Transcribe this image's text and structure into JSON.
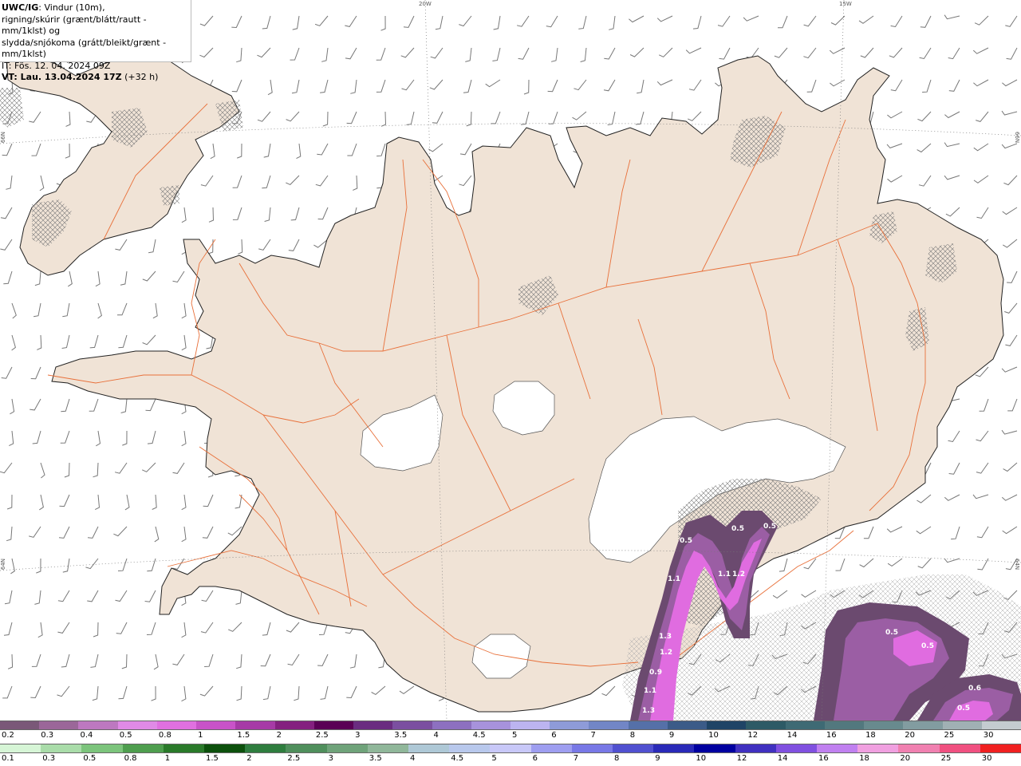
{
  "header": {
    "model": "UWC/IG",
    "line1": ": Vindur (10m),",
    "line2": "rigning/skúrir (grænt/blátt/rautt - mm/1klst) og",
    "line3": "slydda/snjókoma (grátt/bleikt/grænt - mm/1klst)",
    "it_line": "IT: Fös. 12. 04. 2024 09Z",
    "vt_label": "VT: Lau. 13.04.2024 17Z",
    "vt_offset": " (+32 h)"
  },
  "graticule": {
    "lon_labels": [
      "20W",
      "15W"
    ],
    "lat_labels": [
      "66N",
      "66N",
      "64N",
      "64N"
    ]
  },
  "map_values": [
    {
      "label": "0.5",
      "id": "v1"
    },
    {
      "label": "0.5",
      "id": "v2"
    },
    {
      "label": "0.5",
      "id": "v3"
    },
    {
      "label": "1.1",
      "id": "v4"
    },
    {
      "label": "1.1",
      "id": "v5"
    },
    {
      "label": "1.2",
      "id": "v6"
    },
    {
      "label": "1.3",
      "id": "v7"
    },
    {
      "label": "1.2",
      "id": "v8"
    },
    {
      "label": "0.9",
      "id": "v9"
    },
    {
      "label": "1.1",
      "id": "v10"
    },
    {
      "label": "1.3",
      "id": "v11"
    },
    {
      "label": "0.5",
      "id": "v12"
    },
    {
      "label": "0.5",
      "id": "v13"
    },
    {
      "label": "0.6",
      "id": "v14"
    },
    {
      "label": "0.5",
      "id": "v15"
    }
  ],
  "legend_snow": {
    "labels": [
      "0.2",
      "0.3",
      "0.4",
      "0.5",
      "0.8",
      "1",
      "1.5",
      "2",
      "2.5",
      "3",
      "3.5",
      "4",
      "4.5",
      "5",
      "6",
      "7",
      "8",
      "9",
      "10",
      "12",
      "14",
      "16",
      "18",
      "20",
      "25",
      "30"
    ],
    "colors": [
      "#7a5878",
      "#9b6799",
      "#bd78c0",
      "#e08ae6",
      "#e070e0",
      "#c853c8",
      "#a63aa6",
      "#84207f",
      "#5a0055",
      "#6a2c80",
      "#7b4fa0",
      "#8d70c0",
      "#a792dc",
      "#bcb4f0",
      "#8e9bd8",
      "#7286c6",
      "#5570a8",
      "#3b5b88",
      "#1f4466",
      "#2d5a66",
      "#3e6a74",
      "#52787e",
      "#688a8e",
      "#829ca0",
      "#a0b0b4",
      "#c4ccd0"
    ]
  },
  "legend_rain": {
    "labels": [
      "0.1",
      "0.3",
      "0.5",
      "0.8",
      "1",
      "1.5",
      "2",
      "2.5",
      "3",
      "3.5",
      "4",
      "4.5",
      "5",
      "6",
      "7",
      "8",
      "9",
      "10",
      "12",
      "14",
      "16",
      "18",
      "20",
      "25",
      "30"
    ],
    "colors": [
      "#d6f5d6",
      "#a9dca9",
      "#7cc47c",
      "#4e9e4e",
      "#2a7a2a",
      "#0c500c",
      "#2e7d3e",
      "#4f8f5c",
      "#6fa37a",
      "#90b79a",
      "#aec8d6",
      "#b8c8ec",
      "#c8c8f8",
      "#9e9ef0",
      "#7878e6",
      "#5050d0",
      "#2a2ab8",
      "#0000a0",
      "#4030c0",
      "#8050e0",
      "#c080f0",
      "#f0a0e0",
      "#f080b0",
      "#f05080",
      "#f02020"
    ]
  }
}
